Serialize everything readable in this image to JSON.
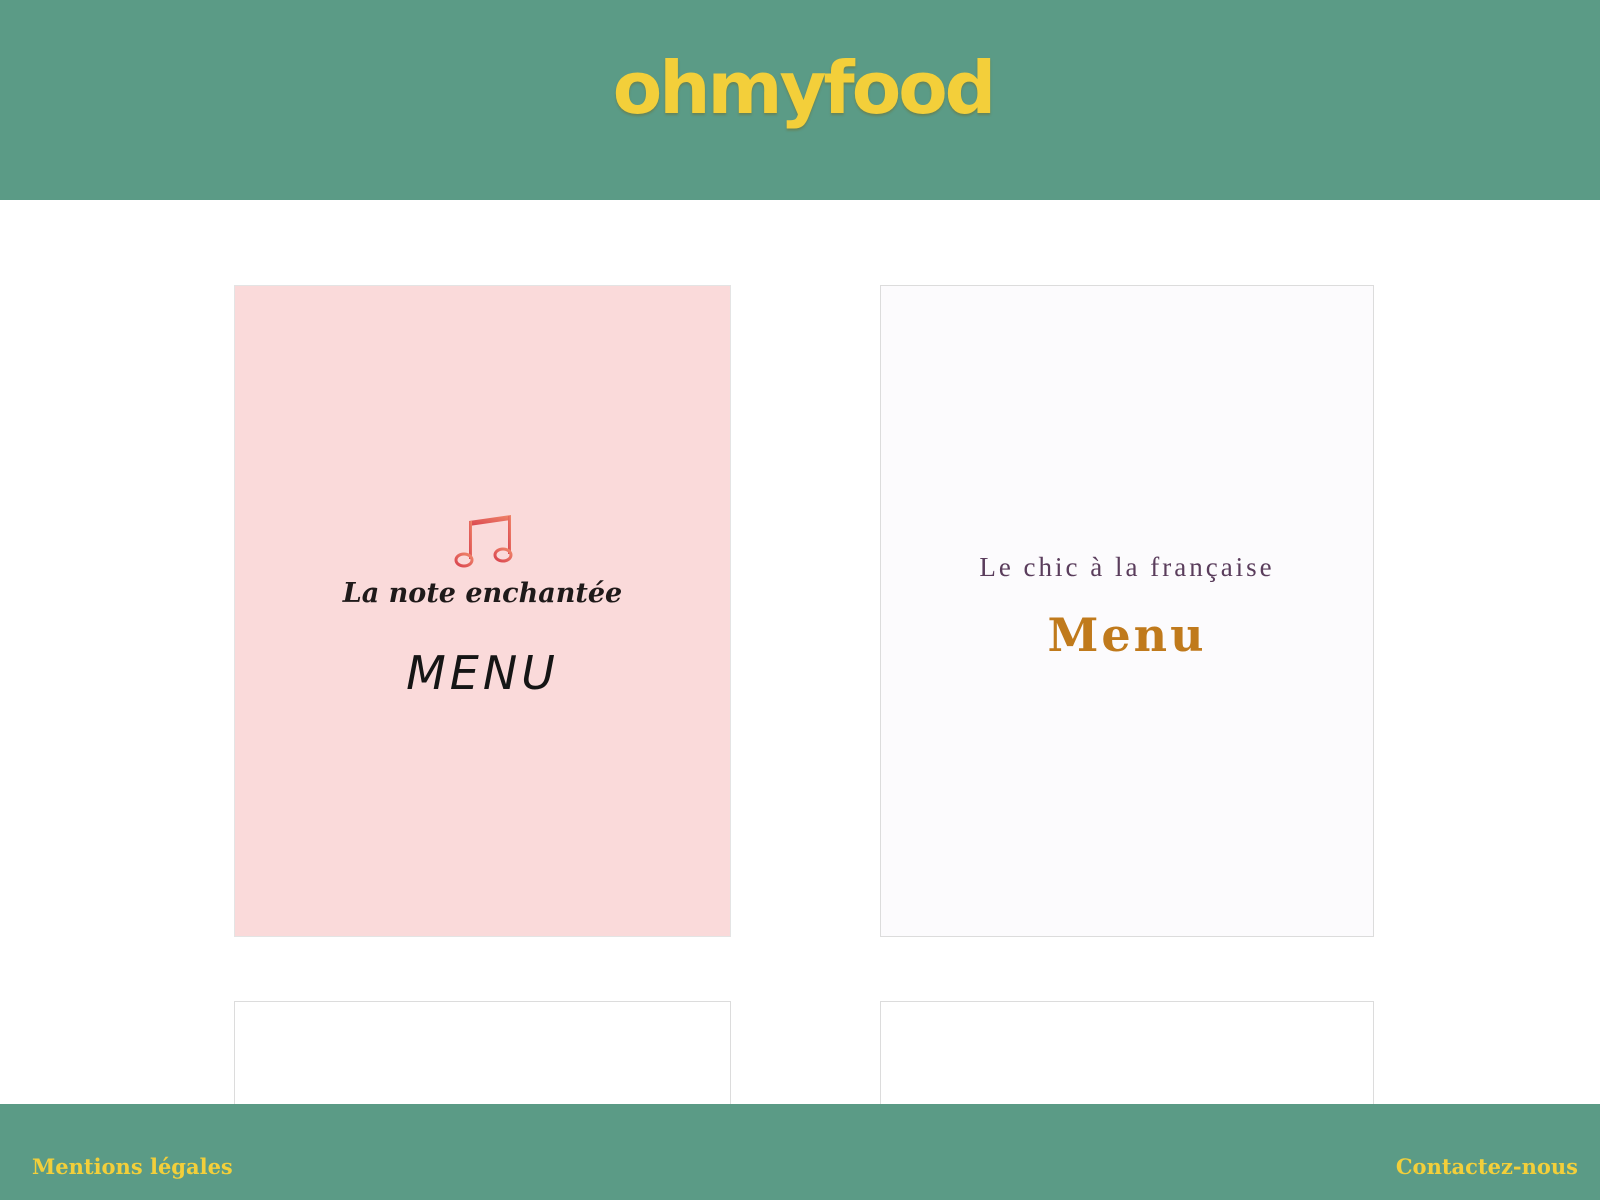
{
  "header": {
    "logo": "ohmyfood"
  },
  "cards": [
    {
      "restaurant_name": "La note enchantée",
      "menu_label": "MENU",
      "icon": "music-note-icon"
    },
    {
      "restaurant_name": "Le chic à la française",
      "menu_label": "Menu"
    }
  ],
  "footer": {
    "left_link": "Mentions légales",
    "right_link": "Contactez-nous"
  },
  "colors": {
    "brand_green": "#5b9b86",
    "brand_yellow": "#f3cf3a",
    "card_pink": "#fadada",
    "menu_gold": "#c07a1c"
  }
}
